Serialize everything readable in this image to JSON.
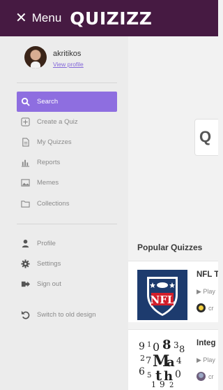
{
  "header": {
    "menu_close": "✕",
    "menu_label": "Menu",
    "logo": "QUIZIZZ",
    "bg_color": "#461a42"
  },
  "user": {
    "name": "akritikos",
    "view_profile": "View profile"
  },
  "nav": {
    "primary": [
      {
        "label": "Search",
        "icon": "search-icon",
        "active": true
      },
      {
        "label": "Create a Quiz",
        "icon": "plus-square-icon"
      },
      {
        "label": "My Quizzes",
        "icon": "document-icon"
      },
      {
        "label": "Reports",
        "icon": "bar-chart-icon"
      },
      {
        "label": "Memes",
        "icon": "image-icon"
      },
      {
        "label": "Collections",
        "icon": "folder-icon"
      }
    ],
    "secondary": [
      {
        "label": "Profile",
        "icon": "user-icon"
      },
      {
        "label": "Settings",
        "icon": "gear-icon"
      },
      {
        "label": "Sign out",
        "icon": "sign-out-icon"
      },
      {
        "label": "Switch to old design",
        "icon": "undo-icon"
      }
    ],
    "accent_color": "#8e6ee0"
  },
  "main": {
    "search_glyph": "Q",
    "popular_heading": "Popular Quizzes",
    "quizzes": [
      {
        "title": "NFL T",
        "play": "▶ Play",
        "author": "cr",
        "thumb": "nfl-logo"
      },
      {
        "title": "Integ",
        "play": "▶ Play",
        "author": "cr",
        "thumb": "math-numbers-art"
      }
    ]
  }
}
